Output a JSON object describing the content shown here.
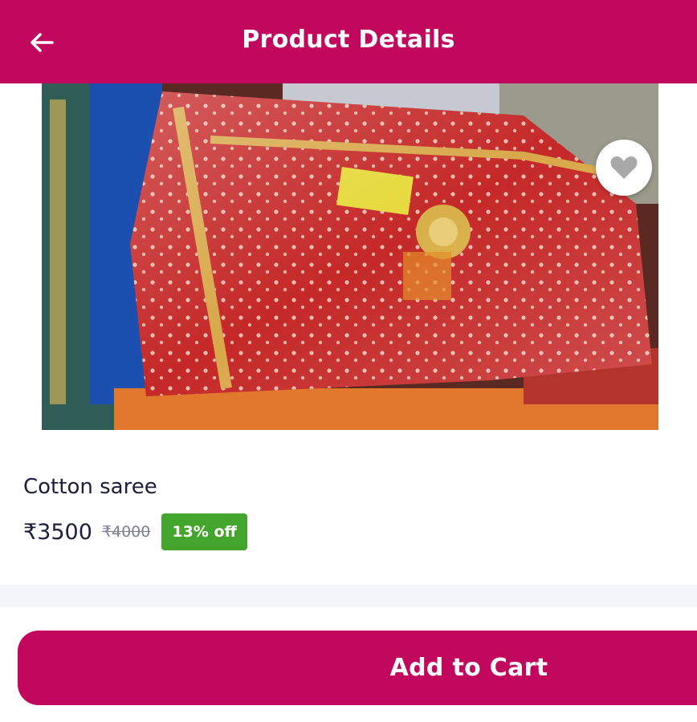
{
  "appbar": {
    "title": "Product Details",
    "back_icon": "arrow-left-icon",
    "color": "#c2075f"
  },
  "product": {
    "favorite_icon": "heart-icon",
    "name": "Cotton saree",
    "price": "₹3500",
    "mrp": "₹4000",
    "discount": "13% off",
    "discount_color": "#43a52b"
  },
  "actions": {
    "add_to_cart": "Add to Cart"
  }
}
